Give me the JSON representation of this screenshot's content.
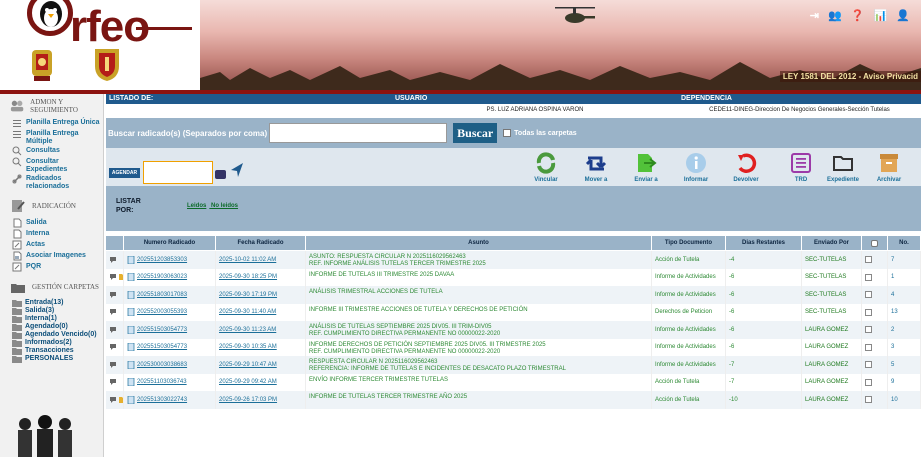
{
  "banner": {
    "logo_text": "rfeo",
    "ley_text": "LEY 1581 DEL 2012 - Aviso Privacid",
    "top_icons": [
      "logout-icon",
      "users-icon",
      "help-icon",
      "stats-icon",
      "user-icon",
      "more-icon"
    ]
  },
  "sidebar": {
    "admin_head": "ADMON Y SEGUIMIENTO",
    "admin_items": [
      {
        "label": "Planilla Entrega Única",
        "icon": "list-icon"
      },
      {
        "label": "Planilla Entrega Múltiple",
        "icon": "list-icon"
      },
      {
        "label": "Consultas",
        "icon": "search-icon"
      },
      {
        "label": "Consultar Expedientes",
        "icon": "search-icon"
      },
      {
        "label": "Radicados relacionados",
        "icon": "link-icon"
      }
    ],
    "rad_head": "RADICACIÓN",
    "rad_items": [
      {
        "label": "Salida",
        "icon": "doc-icon"
      },
      {
        "label": "Interna",
        "icon": "doc-icon"
      },
      {
        "label": "Actas",
        "icon": "edit-icon"
      },
      {
        "label": "Asociar Imagenes",
        "icon": "image-doc-icon"
      },
      {
        "label": "PQR",
        "icon": "edit-icon"
      }
    ],
    "carpetas_head": "GESTIÓN CARPETAS",
    "folders": [
      "Entrada(13)",
      "Salida(3)",
      "Interna(1)",
      "Agendado(0)",
      "Agendado Vencido(0)",
      "Informados(2)",
      "Transacciones",
      "PERSONALES"
    ]
  },
  "header": {
    "listado_label": "LISTADO DE:",
    "usuario_label": "USUARIO",
    "usuario_value": "PS. LUZ ADRIANA OSPINA VARON",
    "dependencia_label": "DEPENDENCIA",
    "dependencia_value": "CEDE11-DINEG-Direccion De Negocios Generales-Sección Tutelas"
  },
  "search": {
    "label": "Buscar radicado(s) (Separados por coma)",
    "value": "",
    "button": "Buscar",
    "checkbox_label": "Todas las carpetas"
  },
  "toolbar": {
    "agendar": "AGENDAR",
    "tools": [
      {
        "label": "Vincular",
        "icon": "link-refresh-icon",
        "color": "#4a9a3d"
      },
      {
        "label": "Mover a",
        "icon": "move-icon",
        "color": "#1c3d8c"
      },
      {
        "label": "Enviar a",
        "icon": "send-icon",
        "color": "#52c23a"
      },
      {
        "label": "Informar",
        "icon": "info-icon",
        "color": "#7fb6e0"
      },
      {
        "label": "Devolver",
        "icon": "return-icon",
        "color": "#e02020"
      },
      {
        "label": "TRD",
        "icon": "list-icon",
        "color": "#9c3aa8"
      },
      {
        "label": "Expediente",
        "icon": "folder-icon",
        "color": "#333333"
      },
      {
        "label": "Archivar",
        "icon": "archive-icon",
        "color": "#c98a3a"
      }
    ]
  },
  "listar": {
    "label_line1": "LISTAR",
    "label_line2": "POR:",
    "leidos": "Leidos",
    "no_leidos": "No leidos"
  },
  "table": {
    "headers": [
      "",
      "Numero Radicado",
      "Fecha Radicado",
      "Asunto",
      "Tipo Documento",
      "Dias Restantes",
      "Enviado Por",
      "",
      "No."
    ],
    "rows": [
      {
        "icons": 1,
        "radicado": "202551203853303",
        "fecha": "2025-10-02 11:02 AM",
        "asunto": "ASUNTO: RESPUESTA CIRCULAR N 2025116029562463\nREF. INFORME ANÁLISIS TUTELAS TERCER TRIMESTRE 2025",
        "tipo": "Acción de Tutela",
        "dias": "-4",
        "enviado": "SEC-TUTELAS",
        "no": "7"
      },
      {
        "icons": 2,
        "radicado": "202551903063023",
        "fecha": "2025-09-30 18:25 PM",
        "asunto": "INFORME DE TUTELAS III TRIMESTRE 2025 DAVAA",
        "tipo": "Informe de Actividades",
        "dias": "-6",
        "enviado": "SEC-TUTELAS",
        "no": "1"
      },
      {
        "icons": 1,
        "radicado": "202551803017083",
        "fecha": "2025-09-30 17:19 PM",
        "asunto": "ANÁLISIS TRIMESTRAL ACCIONES DE TUTELA",
        "tipo": "Informe de Actividades",
        "dias": "-6",
        "enviado": "SEC-TUTELAS",
        "no": "4"
      },
      {
        "icons": 1,
        "radicado": "202552003055393",
        "fecha": "2025-09-30 11:40 AM",
        "asunto": "INFORME III TRIMESTRE ACCIONES DE TUTELA Y DERECHOS DE PETICIÓN",
        "tipo": "Derechos de Peticion",
        "dias": "-6",
        "enviado": "SEC-TUTELAS",
        "no": "13"
      },
      {
        "icons": 1,
        "radicado": "202551503054773",
        "fecha": "2025-09-30 11:23 AM",
        "asunto": "ANÁLISIS DE TUTELAS SEPTIEMBRE 2025 DIV05. III TRIM-DIV05\nREF. CUMPLIMIENTO DIRECTIVA PERMANENTE NO 00000022-2020",
        "tipo": "Informe de Actividades",
        "dias": "-6",
        "enviado": "LAURA GOMEZ",
        "no": "2"
      },
      {
        "icons": 1,
        "radicado": "202551503054773",
        "fecha": "2025-09-30 10:35 AM",
        "asunto": "INFORME DERECHOS DE PETICIÓN SEPTIEMBRE 2025 DIV05. III TRIMESTRE 2025\nREF. CUMPLIMIENTO DIRECTIVA PERMANENTE NO 00000022-2020",
        "tipo": "Informe de Actividades",
        "dias": "-6",
        "enviado": "LAURA GOMEZ",
        "no": "3"
      },
      {
        "icons": 1,
        "radicado": "202530003038683",
        "fecha": "2025-09-29 10:47 AM",
        "asunto": "RESPUESTA CIRCULAR N 2025116029562463\nREFERENCIA: INFORME DE TUTELAS E INCIDENTES DE DESACATO PLAZO TRIMESTRAL",
        "tipo": "Informe de Actividades",
        "dias": "-7",
        "enviado": "LAURA GOMEZ",
        "no": "5"
      },
      {
        "icons": 1,
        "radicado": "202551103036743",
        "fecha": "2025-09-29 09:42 AM",
        "asunto": "ENVÍO INFORME TERCER TRIMESTRE TUTELAS",
        "tipo": "Acción de Tutela",
        "dias": "-7",
        "enviado": "LAURA GOMEZ",
        "no": "9"
      },
      {
        "icons": 2,
        "radicado": "202551303022743",
        "fecha": "2025-09-26 17:03 PM",
        "asunto": "INFORME DE TUTELAS TERCER TRIMESTRE AÑO 2025",
        "tipo": "Acción de Tutela",
        "dias": "-10",
        "enviado": "LAURA GOMEZ",
        "no": "10"
      }
    ]
  }
}
